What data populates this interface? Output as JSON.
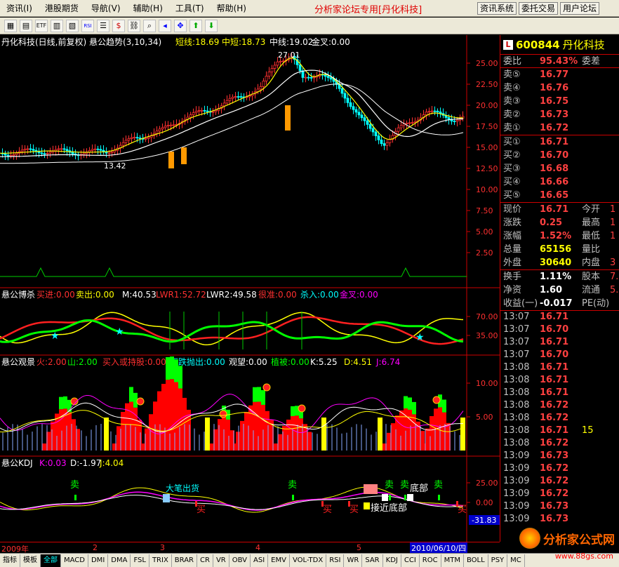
{
  "menu": [
    "资讯(I)",
    "港股期货",
    "导航(V)",
    "辅助(H)",
    "工具(T)",
    "帮助(H)"
  ],
  "menu_title": "分析家论坛专用[丹化科技]",
  "right_buttons": [
    "资讯系统",
    "委托交易",
    "用户论坛"
  ],
  "toolbar_icons": [
    "chart-icon",
    "grid-icon",
    "etf-icon",
    "kline-icon",
    "candle-icon",
    "rsi-icon",
    "list-icon",
    "dollar-icon",
    "link-icon",
    "zoom-icon",
    "left-icon",
    "move-icon",
    "up-icon",
    "down-icon"
  ],
  "main_chart": {
    "header": "丹化科技(日线,前复权) 悬公趋势(3,10,34)",
    "short_label": "短线:18.69",
    "mid_short_label": "中短:18.73",
    "mid_label": "中线:19.02",
    "cross_label": "金叉:0.00",
    "high_mark": "27.01",
    "low_mark": "13.42",
    "y_ticks": [
      "25.00",
      "22.50",
      "20.00",
      "17.50",
      "15.00",
      "12.50",
      "10.00",
      "7.50",
      "5.00",
      "2.50"
    ]
  },
  "panel2": {
    "title": "悬公博杀",
    "buy_in": "买进:0.00",
    "sell_out": "卖出:0.00",
    "m": "M:40.53",
    "lwr1": "LWR1:52.72",
    "lwr2": "LWR2:49.58",
    "strong_kill": "很准:0.00",
    "kill_in": "杀入:0.00",
    "gold_cross": "金叉:0.00",
    "y_ticks": [
      "70.00",
      "35.00"
    ]
  },
  "panel3": {
    "title": "悬公观景",
    "fire": "火:2.00",
    "mountain": "山:2.00",
    "buy_hold": "买入或持股:0.00",
    "drop_sell": "下跌抛出:0.00",
    "watch": "观望:0.00",
    "plant": "植被:0.00",
    "k": "K:5.25",
    "d": "D:4.51",
    "j": "J:6.74",
    "y_ticks": [
      "10.00",
      "5.00"
    ]
  },
  "panel4": {
    "title": "悬公KDJ",
    "k": "K:0.03",
    "d": "D:-1.97",
    "j": "J:4.04",
    "y_ticks": [
      "25.00",
      "0.00"
    ],
    "current": "-31.83",
    "sell_label": "卖",
    "buy_label": "买",
    "bottom_label": "底部",
    "near_bottom_label": "接近底部",
    "big_pen_label": "大笔出货"
  },
  "time_axis": {
    "year": "2009年",
    "months": [
      "2",
      "3",
      "4",
      "5"
    ],
    "current_date": "2010/06/10/四"
  },
  "quote": {
    "code": "600844",
    "name": "丹化科技",
    "ratio_label": "委比",
    "ratio_val": "95.43%",
    "diff_label": "委差",
    "asks": [
      {
        "label": "卖⑤",
        "price": "16.77"
      },
      {
        "label": "卖④",
        "price": "16.76"
      },
      {
        "label": "卖③",
        "price": "16.75"
      },
      {
        "label": "卖②",
        "price": "16.73"
      },
      {
        "label": "卖①",
        "price": "16.72"
      }
    ],
    "bids": [
      {
        "label": "买①",
        "price": "16.71"
      },
      {
        "label": "买②",
        "price": "16.70"
      },
      {
        "label": "买③",
        "price": "16.68"
      },
      {
        "label": "买④",
        "price": "16.66"
      },
      {
        "label": "买⑤",
        "price": "16.65"
      }
    ],
    "stats": [
      {
        "l1": "现价",
        "v1": "16.71",
        "l2": "今开",
        "v2": "1"
      },
      {
        "l1": "涨跌",
        "v1": "0.25",
        "l2": "最高",
        "v2": "1"
      },
      {
        "l1": "涨幅",
        "v1": "1.52%",
        "l2": "最低",
        "v2": "1"
      },
      {
        "l1": "总量",
        "v1": "65156",
        "l2": "量比",
        "v2": ""
      },
      {
        "l1": "外盘",
        "v1": "30640",
        "l2": "内盘",
        "v2": "3"
      }
    ],
    "stats2": [
      {
        "l1": "换手",
        "v1": "1.11%",
        "l2": "股本",
        "v2": "7."
      },
      {
        "l1": "净资",
        "v1": "1.60",
        "l2": "流通",
        "v2": "5."
      },
      {
        "l1": "收益(一)",
        "v1": "-0.017",
        "l2": "PE(动)",
        "v2": ""
      }
    ],
    "ticks": [
      {
        "t": "13:07",
        "p": "16.71",
        "v": ""
      },
      {
        "t": "13:07",
        "p": "16.70",
        "v": ""
      },
      {
        "t": "13:07",
        "p": "16.71",
        "v": ""
      },
      {
        "t": "13:07",
        "p": "16.70",
        "v": ""
      },
      {
        "t": "13:08",
        "p": "16.71",
        "v": ""
      },
      {
        "t": "13:08",
        "p": "16.71",
        "v": ""
      },
      {
        "t": "13:08",
        "p": "16.71",
        "v": ""
      },
      {
        "t": "13:08",
        "p": "16.72",
        "v": ""
      },
      {
        "t": "13:08",
        "p": "16.72",
        "v": ""
      },
      {
        "t": "13:08",
        "p": "16.71",
        "v": "15"
      },
      {
        "t": "13:08",
        "p": "16.72",
        "v": ""
      },
      {
        "t": "13:09",
        "p": "16.73",
        "v": ""
      },
      {
        "t": "13:09",
        "p": "16.72",
        "v": ""
      },
      {
        "t": "13:09",
        "p": "16.72",
        "v": ""
      },
      {
        "t": "13:09",
        "p": "16.72",
        "v": ""
      },
      {
        "t": "13:09",
        "p": "16.73",
        "v": ""
      },
      {
        "t": "13:09",
        "p": "16.73",
        "v": ""
      }
    ]
  },
  "tabs": [
    "指标",
    "模板",
    "全部",
    "MACD",
    "DMI",
    "DMA",
    "FSL",
    "TRIX",
    "BRAR",
    "CR",
    "VR",
    "OBV",
    "ASI",
    "EMV",
    "VOL-TDX",
    "RSI",
    "WR",
    "SAR",
    "KDJ",
    "CCI",
    "ROC",
    "MTM",
    "BOLL",
    "PSY",
    "MC"
  ],
  "watermark": {
    "text": "分析家公式网",
    "url": "www.88gs.com"
  },
  "colors": {
    "up": "#ff3030",
    "down": "#00ffff",
    "ma_yellow": "#ffff00",
    "ma_white": "#ffffff",
    "green_band": "#00ff00"
  }
}
